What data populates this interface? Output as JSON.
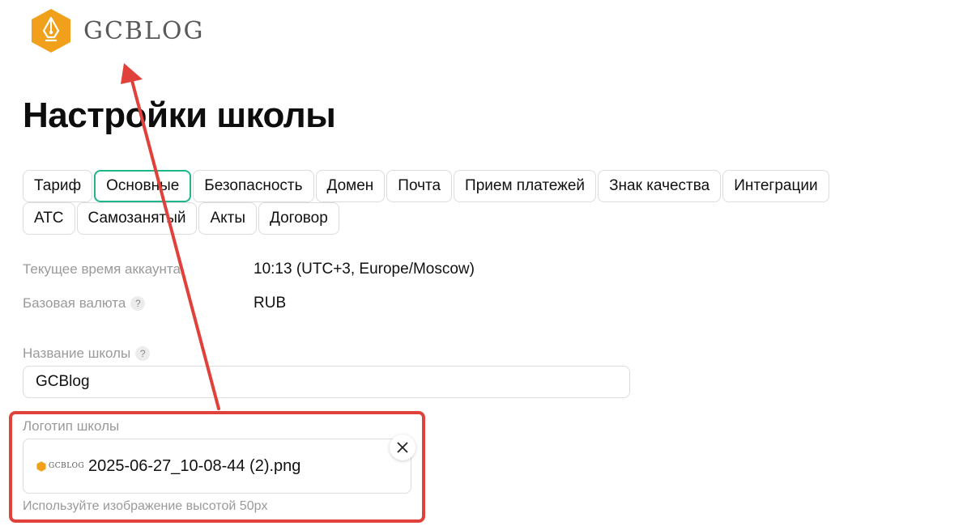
{
  "brand": {
    "name": "GCBLOG",
    "color": "#f0a01a"
  },
  "page_title": "Настройки школы",
  "tabs_row1": [
    "Тариф",
    "Основные",
    "Безопасность",
    "Домен",
    "Почта",
    "Прием платежей",
    "Знак качества",
    "Интеграции"
  ],
  "tabs_row2": [
    "АТС",
    "Самозанятый",
    "Акты",
    "Договор"
  ],
  "active_tab": "Основные",
  "info": {
    "time_label": "Текущее время аккаунта",
    "time_value": "10:13 (UTC+3, Europe/Moscow)",
    "currency_label": "Базовая валюта",
    "currency_value": "RUB",
    "help_icon": "?"
  },
  "school_name": {
    "label": "Название школы",
    "value": "GCBlog"
  },
  "logo_field": {
    "label": "Логотип школы",
    "file_name": "2025-06-27_10-08-44 (2).png",
    "thumb_text": "GCBLOG",
    "hint": "Используйте изображение высотой 50px"
  },
  "colors": {
    "accent": "#1fb58a",
    "annotation": "#e0413a"
  }
}
